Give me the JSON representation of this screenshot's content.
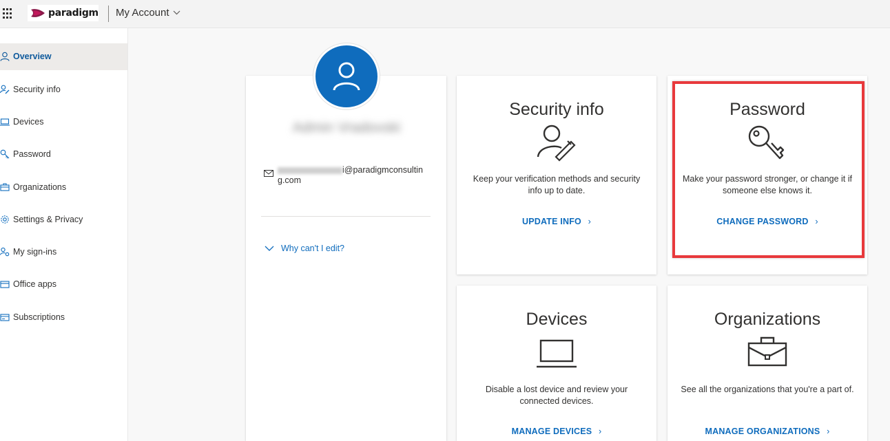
{
  "header": {
    "brand": "paradigm",
    "app_title": "My Account"
  },
  "sidebar": {
    "items": [
      {
        "label": "Overview",
        "icon": "person-icon",
        "active": true
      },
      {
        "label": "Security info",
        "icon": "person-key-icon"
      },
      {
        "label": "Devices",
        "icon": "laptop-icon"
      },
      {
        "label": "Password",
        "icon": "key-icon"
      },
      {
        "label": "Organizations",
        "icon": "briefcase-icon"
      },
      {
        "label": "Settings & Privacy",
        "icon": "gear-icon"
      },
      {
        "label": "My sign-ins",
        "icon": "sign-in-icon"
      },
      {
        "label": "Office apps",
        "icon": "apps-icon"
      },
      {
        "label": "Subscriptions",
        "icon": "card-icon"
      }
    ]
  },
  "profile": {
    "name": "Admin Vradovski",
    "email_suffix": "i@paradigmconsultin",
    "email_wrap": "g.com",
    "why_link": "Why can't I edit?"
  },
  "cards": {
    "security": {
      "title": "Security info",
      "desc": "Keep your verification methods and security info up to date.",
      "link": "UPDATE INFO"
    },
    "password": {
      "title": "Password",
      "desc": "Make your password stronger, or change it if someone else knows it.",
      "link": "CHANGE PASSWORD"
    },
    "devices": {
      "title": "Devices",
      "desc": "Disable a lost device and review your connected devices.",
      "link": "MANAGE DEVICES"
    },
    "organizations": {
      "title": "Organizations",
      "desc": "See all the organizations that you're a part of.",
      "link": "MANAGE ORGANIZATIONS"
    }
  },
  "colors": {
    "accent": "#0f6cbd",
    "highlight": "#e8393c"
  }
}
